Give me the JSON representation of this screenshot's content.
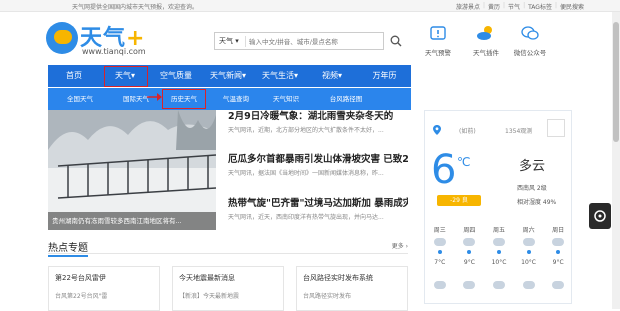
{
  "topbar": {
    "notice": "天气网提供全国国内城市天气预报，欢迎查询。",
    "links": [
      "旅游景点",
      "黄历",
      "节气",
      "TAG标签",
      "便民搜索"
    ]
  },
  "logo": {
    "brand": "天气",
    "plus": "+",
    "url": "www.tianqi.com"
  },
  "search": {
    "select": "天气",
    "placeholder": "输入中文/拼音、城市/景点名称"
  },
  "header_tools": [
    {
      "label": "天气预警"
    },
    {
      "label": "天气插件"
    },
    {
      "label": "微信公众号"
    }
  ],
  "nav_primary": [
    "首页",
    "天气",
    "空气质量",
    "天气新闻",
    "天气生活",
    "视频",
    "万年历"
  ],
  "nav_secondary": [
    "全国天气",
    "国际天气",
    "历史天气",
    "气温查询",
    "天气知识",
    "台风路径图"
  ],
  "hero": {
    "caption": "贵州湖南仍有冻雨雪较多西南江南地区将有..."
  },
  "news": [
    {
      "title": "2月9日冷暖气象：湖北雨雪夹杂冬天的",
      "desc": "天气网讯，近期，北方部分地区的大气扩散条件不太好，..."
    },
    {
      "title": "厄瓜多尔首都暴雨引发山体滑坡灾害 已致28人",
      "desc": "天气网讯，据法国《当地时间》一国新闻媒体消息称，昨..."
    },
    {
      "title": "热带气旋\"巴齐雷\"过境马达加斯加 暴雨成灾",
      "desc": "天气网讯，近天，西南印度洋有热带气旋出现，并向马达..."
    }
  ],
  "weather": {
    "date_label": "(如前)",
    "count": "1354观测",
    "temperature": "6",
    "unit": "℃",
    "condition": "多云",
    "range": "-29 良",
    "wind": "西南风 2级",
    "humidity": "相对湿度 49%",
    "forecast": [
      {
        "day": "周三",
        "temp": "7°C"
      },
      {
        "day": "周四",
        "temp": "9°C"
      },
      {
        "day": "周五",
        "temp": "10°C"
      },
      {
        "day": "周六",
        "temp": "10°C"
      },
      {
        "day": "周日",
        "temp": "9°C"
      }
    ]
  },
  "hot": {
    "title": "热点专题",
    "more": "更多 ›"
  },
  "cards": [
    {
      "title": "第22号台风雷伊",
      "sub": "台风第22号台风\"雷"
    },
    {
      "title": "今天地震最新消息",
      "sub": "【新浪】今天最新地震"
    },
    {
      "title": "台风路径实时发布系统",
      "sub": "台风路径实时发布"
    }
  ],
  "colors": {
    "nav_primary": "#1e6fd9",
    "nav_secondary": "#2b85ec",
    "accent": "#2e8ce6",
    "highlight": "#d9232a"
  }
}
